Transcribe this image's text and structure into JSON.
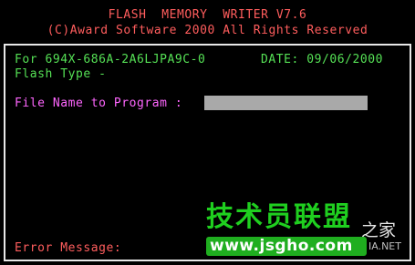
{
  "header": {
    "title": "FLASH  MEMORY  WRITER V7.6",
    "copyright": "(C)Award Software 2000 All Rights Reserved"
  },
  "info": {
    "bios_id": "For 694X-686A-2A6LJPA9C-0",
    "date": "DATE: 09/06/2000",
    "flash_type": "Flash Type -"
  },
  "program": {
    "prompt": "File Name to Program :",
    "value": "",
    "placeholder": ""
  },
  "status": {
    "error_label": "Error Message:"
  },
  "watermark": {
    "brand": "技术员联盟",
    "side_text": "之家",
    "url": "www.jsgho.com",
    "suffix": "IA.NET"
  },
  "colors": {
    "background": "#000000",
    "header_text": "#ff5d5d",
    "info_text": "#55e055",
    "prompt_text": "#ff66ff",
    "input_fill": "#a9a9a9",
    "frame_border": "#e8e8e8"
  }
}
